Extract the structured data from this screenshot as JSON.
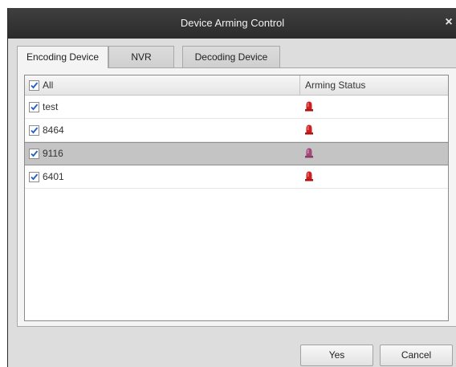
{
  "window": {
    "title": "Device Arming Control",
    "close_glyph": "×"
  },
  "tabs": [
    {
      "label": "Encoding Device",
      "active": true
    },
    {
      "label": "NVR",
      "active": false
    },
    {
      "label": "Decoding Device",
      "active": false
    }
  ],
  "table": {
    "select_all_label": "All",
    "select_all_checked": true,
    "status_header": "Arming Status",
    "rows": [
      {
        "name": "test",
        "checked": true,
        "status_icon": "alarm-icon",
        "status_color": "#cc1f1f",
        "selected": false
      },
      {
        "name": "8464",
        "checked": true,
        "status_icon": "alarm-icon",
        "status_color": "#cc1f1f",
        "selected": false
      },
      {
        "name": "9116",
        "checked": true,
        "status_icon": "alarm-icon",
        "status_color": "#a04a78",
        "selected": true
      },
      {
        "name": "6401",
        "checked": true,
        "status_icon": "alarm-icon",
        "status_color": "#cc1f1f",
        "selected": false
      }
    ]
  },
  "buttons": {
    "yes_label": "Yes",
    "cancel_label": "Cancel"
  },
  "colors": {
    "titlebar": "#333333",
    "checkmark": "#1f5fc4",
    "selected_row": "#c4c4c4"
  }
}
